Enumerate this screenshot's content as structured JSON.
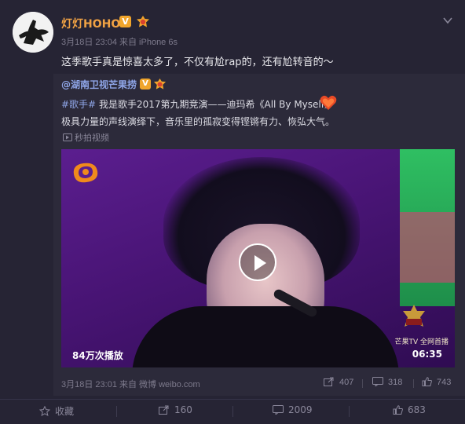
{
  "post": {
    "username": "灯灯HOHO",
    "verified_badge": "V",
    "meta": "3月18日 23:04 来自 iPhone 6s",
    "text": "这季歌手真是惊喜太多了，不仅有尬rap的，还有尬转音的～"
  },
  "repost": {
    "username": "@湖南卫视芒果捞",
    "verified_badge": "V",
    "tag": "#歌手#",
    "line1_rest": " 我是歌手2017第九期竞演——迪玛希《All By Myself》",
    "line2": "极具力量的声线演绎下，音乐里的孤寂变得铿锵有力、恢弘大气。",
    "video_link": "秒拍视频",
    "video": {
      "views": "84万次播放",
      "duration": "06:35",
      "channel": "芒果TV 全网首播"
    },
    "meta": "3月18日 23:01 来自 微博 weibo.com",
    "actions": {
      "repost_count": "407",
      "comment_count": "318",
      "like_count": "743"
    }
  },
  "bottom_bar": {
    "favorite_label": "收藏",
    "repost_count": "160",
    "comment_count": "2009",
    "like_count": "683"
  },
  "colors": {
    "background": "#262434",
    "username": "#f0a244",
    "link": "#8fa6e8",
    "muted": "#7d7a8c"
  },
  "icons": [
    "chevron-down-icon",
    "video-icon",
    "play-icon",
    "share-icon",
    "comment-icon",
    "like-icon",
    "star-icon",
    "heart-icon"
  ]
}
